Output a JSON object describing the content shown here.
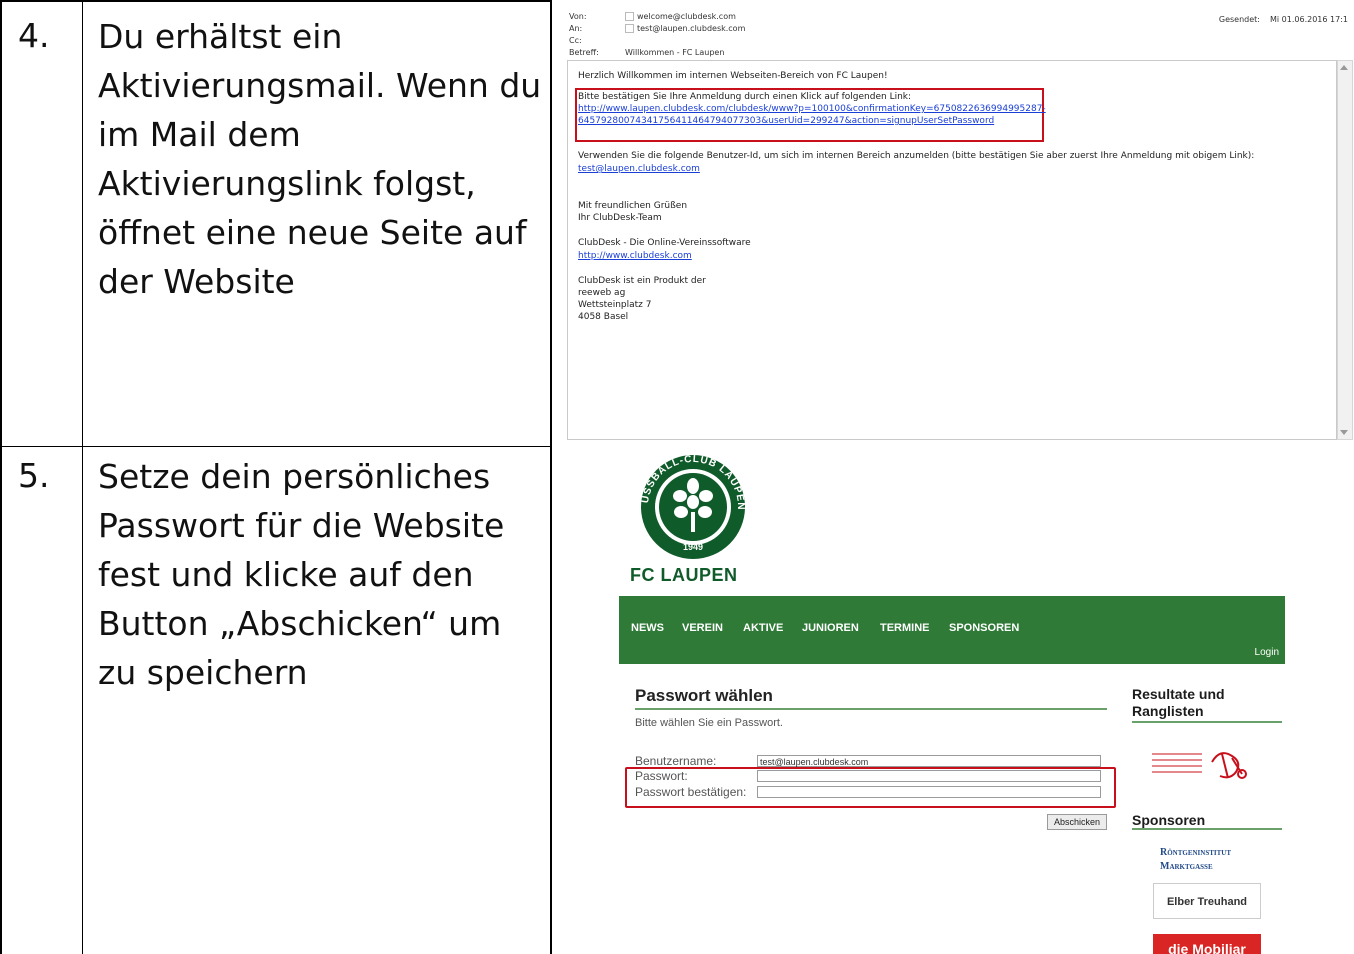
{
  "steps": [
    {
      "number": "4.",
      "lines": [
        "Du erhältst ein",
        "Aktivierungsmail. Wenn du",
        "im Mail dem",
        "Aktivierungslink folgst,",
        "öffnet eine neue Seite auf",
        "der Website"
      ]
    },
    {
      "number": "5.",
      "lines": [
        "Setze dein persönliches",
        "Passwort für die Website",
        "fest und klicke auf den",
        "Button „Abschicken“ um",
        "zu speichern"
      ]
    }
  ],
  "email": {
    "from_label": "Von:",
    "from": "welcome@clubdesk.com",
    "to_label": "An:",
    "to": "test@laupen.clubdesk.com",
    "cc_label": "Cc:",
    "subject_label": "Betreff:",
    "subject": "Willkommen - FC Laupen",
    "sent_label": "Gesendet:",
    "sent": "Mi 01.06.2016 17:1",
    "body": {
      "greeting": "Herzlich Willkommen im internen Webseiten-Bereich von FC Laupen!",
      "confirm_text": "Bitte bestätigen Sie Ihre Anmeldung durch einen Klick auf folgenden Link:",
      "link_line1": "http://www.laupen.clubdesk.com/clubdesk/www?p=100100&confirmationKey=6750822636994995287-",
      "link_line2": "6457928007434175641146479407730​3&userUid=299247&action=signupUserSetPassword",
      "userid_text": "Verwenden Sie die folgende Benutzer-Id, um sich im internen Bereich anzumelden (bitte bestätigen Sie aber zuerst Ihre Anmeldung mit obigem Link):",
      "userid": "test@laupen.clubdesk.com",
      "regards": "Mit freundlichen Grüßen",
      "team": "Ihr ClubDesk-Team",
      "product": "ClubDesk - Die Online-Vereinssoftware",
      "product_url": "http://www.clubdesk.com",
      "company_intro": "ClubDesk ist ein Produkt der",
      "company": "reeweb ag",
      "street": "Wettsteinplatz 7",
      "city": "4058 Basel"
    }
  },
  "website": {
    "club_name": "FC LAUPEN",
    "logo_ring_text": "FUSSBALL-CLUB LAUPEN",
    "logo_year": "1949",
    "nav": [
      "NEWS",
      "VEREIN",
      "AKTIVE",
      "JUNIOREN",
      "TERMINE",
      "SPONSOREN"
    ],
    "login": "Login",
    "form": {
      "title": "Passwort wählen",
      "hint": "Bitte wählen Sie ein Passwort.",
      "username_label": "Benutzername:",
      "username_value": "test@laupen.clubdesk.com",
      "password_label": "Passwort:",
      "confirm_label": "Passwort bestätigen:",
      "submit": "Abschicken"
    },
    "sidebar": {
      "results_title": "Resultate und Ranglisten",
      "sponsors_title": "Sponsoren",
      "sponsor1_line1": "Röntgeninstitut",
      "sponsor1_line2": "Marktgasse",
      "sponsor2": "Elber Treuhand",
      "sponsor3": "die Mobiliar"
    },
    "colors": {
      "nav_green": "#2e7a36",
      "logo_green": "#0f5b2a",
      "highlight_red": "#c8101d"
    }
  }
}
